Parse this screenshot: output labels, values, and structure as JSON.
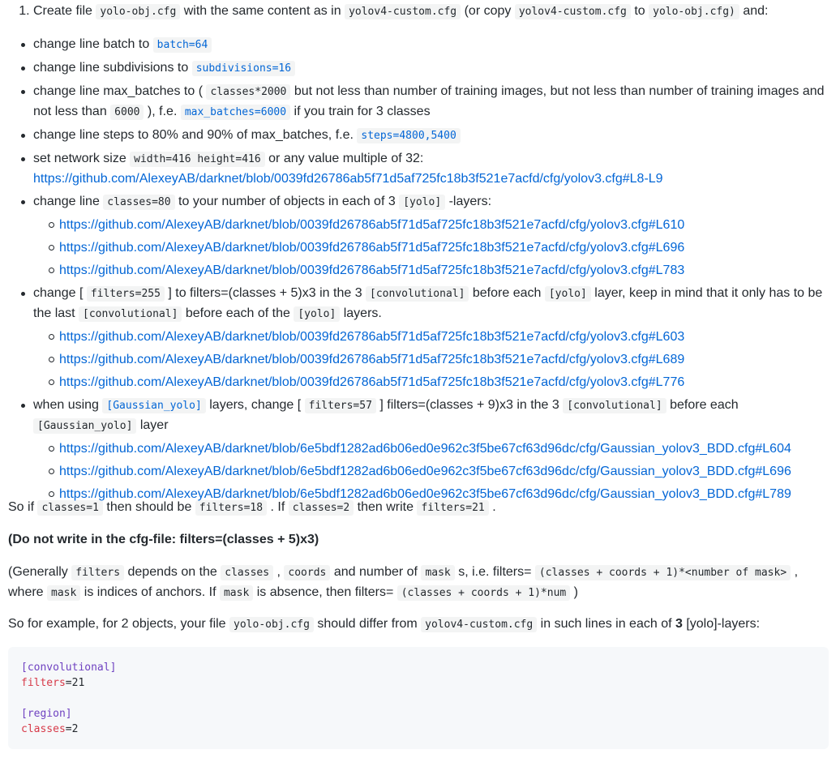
{
  "step1": {
    "number": "1.",
    "t1": "Create file ",
    "c1": "yolo-obj.cfg",
    "t2": " with the same content as in ",
    "c2": "yolov4-custom.cfg",
    "t3": " (or copy ",
    "c3": "yolov4-custom.cfg",
    "t4": " to ",
    "c4": "yolo-obj.cfg)",
    "t5": " and:"
  },
  "bullets": {
    "batch": {
      "t1": "change line batch to ",
      "c1": "batch=64"
    },
    "subdiv": {
      "t1": "change line subdivisions to ",
      "c1": "subdivisions=16"
    },
    "maxb": {
      "t1": "change line max_batches to ( ",
      "c1": "classes*2000",
      "t2": " but not less than number of training images, but not less than number of training images and not less than ",
      "c2": "6000",
      "t3": " ), f.e. ",
      "c3": "max_batches=6000",
      "t4": " if you train for 3 classes"
    },
    "steps": {
      "t1": "change line steps to 80% and 90% of max_batches, f.e. ",
      "c1": "steps=4800,5400"
    },
    "netsize": {
      "t1": "set network size ",
      "c1": "width=416 height=416",
      "t2": " or any value multiple of 32:",
      "link": "https://github.com/AlexeyAB/darknet/blob/0039fd26786ab5f71d5af725fc18b3f521e7acfd/cfg/yolov3.cfg#L8-L9"
    },
    "classes": {
      "t1": "change line ",
      "c1": "classes=80",
      "t2": " to your number of objects in each of 3 ",
      "c2": "[yolo]",
      "t3": " -layers:",
      "links": [
        "https://github.com/AlexeyAB/darknet/blob/0039fd26786ab5f71d5af725fc18b3f521e7acfd/cfg/yolov3.cfg#L610",
        "https://github.com/AlexeyAB/darknet/blob/0039fd26786ab5f71d5af725fc18b3f521e7acfd/cfg/yolov3.cfg#L696",
        "https://github.com/AlexeyAB/darknet/blob/0039fd26786ab5f71d5af725fc18b3f521e7acfd/cfg/yolov3.cfg#L783"
      ]
    },
    "filters": {
      "t1": "change [ ",
      "c1": "filters=255",
      "t2": " ] to filters=(classes + 5)x3 in the 3 ",
      "c2": "[convolutional]",
      "t3": " before each ",
      "c3": "[yolo]",
      "t4": " layer, keep in mind that it only has to be the last ",
      "c4": "[convolutional]",
      "t5": " before each of the ",
      "c5": "[yolo]",
      "t6": " layers.",
      "links": [
        "https://github.com/AlexeyAB/darknet/blob/0039fd26786ab5f71d5af725fc18b3f521e7acfd/cfg/yolov3.cfg#L603",
        "https://github.com/AlexeyAB/darknet/blob/0039fd26786ab5f71d5af725fc18b3f521e7acfd/cfg/yolov3.cfg#L689",
        "https://github.com/AlexeyAB/darknet/blob/0039fd26786ab5f71d5af725fc18b3f521e7acfd/cfg/yolov3.cfg#L776"
      ]
    },
    "gaussian": {
      "t1": "when using ",
      "c1": "[Gaussian_yolo]",
      "t2": " layers, change [ ",
      "c2": "filters=57",
      "t3": " ] filters=(classes + 9)x3 in the 3 ",
      "c3": "[convolutional]",
      "t4": " before each ",
      "c4": "[Gaussian_yolo]",
      "t5": " layer",
      "links": [
        "https://github.com/AlexeyAB/darknet/blob/6e5bdf1282ad6b06ed0e962c3f5be67cf63d96dc/cfg/Gaussian_yolov3_BDD.cfg#L604",
        "https://github.com/AlexeyAB/darknet/blob/6e5bdf1282ad6b06ed0e962c3f5be67cf63d96dc/cfg/Gaussian_yolov3_BDD.cfg#L696",
        "https://github.com/AlexeyAB/darknet/blob/6e5bdf1282ad6b06ed0e962c3f5be67cf63d96dc/cfg/Gaussian_yolov3_BDD.cfg#L789"
      ]
    }
  },
  "para1": {
    "t1": "So if ",
    "c1": "classes=1",
    "t2": " then should be ",
    "c2": "filters=18",
    "t3": " . If ",
    "c3": "classes=2",
    "t4": " then write ",
    "c4": "filters=21",
    "t5": " ."
  },
  "para2": "(Do not write in the cfg-file: filters=(classes + 5)x3)",
  "para3": {
    "t1": "(Generally ",
    "c1": "filters",
    "t2": " depends on the ",
    "c2": "classes",
    "t3": " , ",
    "c3": "coords",
    "t4": " and number of ",
    "c4": "mask",
    "t5": " s, i.e. filters= ",
    "c5": "(classes + coords + 1)*<number of mask>",
    "t6": " , where ",
    "c6": "mask",
    "t7": " is indices of anchors. If ",
    "c7": "mask",
    "t8": " is absence, then filters= ",
    "c8": "(classes + coords + 1)*num",
    "t9": " )"
  },
  "para4": {
    "t1": "So for example, for 2 objects, your file ",
    "c1": "yolo-obj.cfg",
    "t2": " should differ from ",
    "c2": "yolov4-custom.cfg",
    "t3": " in such lines in each of ",
    "b1": "3",
    "t4": " [yolo]-layers:"
  },
  "codeblock": {
    "sec1": "[convolutional]",
    "key1": "filters",
    "eq1": "=",
    "val1": "21",
    "sec2": "[region]",
    "key2": "classes",
    "eq2": "=",
    "val2": "2"
  },
  "colors": {
    "link": "#0366d6",
    "text": "#24292e",
    "code_section": "#6f42c1",
    "code_key": "#d73a49",
    "code_bg": "#f6f8fa"
  }
}
